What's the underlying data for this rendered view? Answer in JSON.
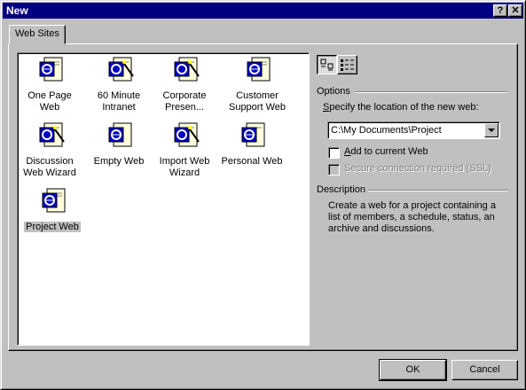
{
  "window": {
    "title": "New",
    "help_label": "?",
    "close_label": "✕"
  },
  "tabs": [
    {
      "label": "Web Sites"
    }
  ],
  "templates": [
    {
      "line1": "One Page",
      "line2": "Web",
      "icon": "web-page-icon"
    },
    {
      "line1": "60 Minute",
      "line2": "Intranet",
      "icon": "web-wizard-icon"
    },
    {
      "line1": "Corporate",
      "line2": "Presen...",
      "icon": "web-wizard-icon"
    },
    {
      "line1": "Customer",
      "line2": "Support Web",
      "icon": "web-page-icon"
    },
    {
      "line1": "Discussion",
      "line2": "Web Wizard",
      "icon": "web-wizard-icon"
    },
    {
      "line1": "Empty Web",
      "line2": "",
      "icon": "web-page-icon"
    },
    {
      "line1": "Import Web",
      "line2": "Wizard",
      "icon": "web-wizard-icon"
    },
    {
      "line1": "Personal Web",
      "line2": "",
      "icon": "web-page-icon"
    },
    {
      "line1": "Project Web",
      "line2": "",
      "icon": "web-page-icon",
      "selected": true
    }
  ],
  "view": {
    "large_icons": "large-icons-view-icon",
    "details": "details-view-icon"
  },
  "options": {
    "group_label": "Options",
    "location_label": "Specify the location of the new web:",
    "location_accel": "S",
    "location_rest": "pecify the location of the new web:",
    "location_value": "C:\\My Documents\\Project",
    "add_current_accel": "A",
    "add_current_rest": "dd to current Web",
    "add_current_checked": false,
    "ssl_label": "Secure connection required (SSL)",
    "ssl_checked": false,
    "ssl_disabled": true
  },
  "description": {
    "group_label": "Description",
    "line1": "Create a web for a project containing a",
    "line2": "list of members, a schedule, status, an",
    "line3": "archive and discussions."
  },
  "buttons": {
    "ok": "OK",
    "cancel": "Cancel"
  }
}
